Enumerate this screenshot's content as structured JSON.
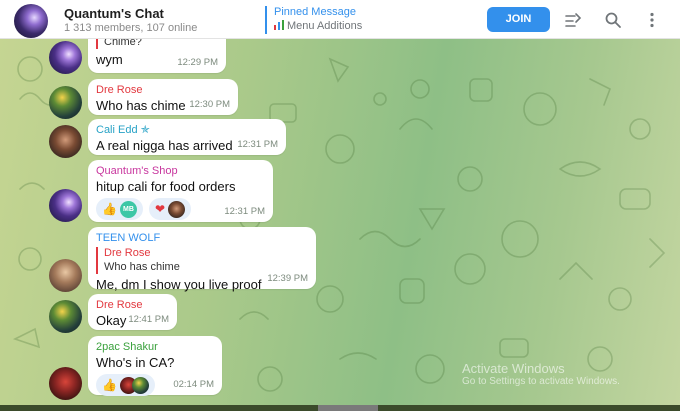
{
  "header": {
    "title": "Quantum's Chat",
    "subtitle": "1 313 members, 107 online",
    "pinned_label": "Pinned Message",
    "pinned_text": "Menu Additions",
    "join_label": "JOIN",
    "icons": [
      "chat-avatar",
      "topics-icon",
      "search-icon",
      "more-vertical-icon"
    ]
  },
  "colors": {
    "accent": "#3390ec",
    "bubble": "#ffffff",
    "dre_rose": "#e2383f",
    "cali_edd": "#27a2c6",
    "quantum_shop": "#c8369e",
    "teen_wolf": "#3390ec",
    "tupac": "#3aa13d"
  },
  "messages": [
    {
      "reply_name": "",
      "reply_text": "Chime?",
      "text": "wym",
      "time": "12:29 PM"
    },
    {
      "sender": "Dre Rose",
      "text": "Who has chime",
      "time": "12:30 PM"
    },
    {
      "sender": "Cali Edd",
      "text": "A real nigga has arrived",
      "time": "12:31 PM"
    },
    {
      "sender": "Quantum's Shop",
      "text": "hitup cali for food orders",
      "time": "12:31 PM",
      "reactions": [
        {
          "emoji": "👍",
          "badge": "MB"
        },
        {
          "emoji": "❤"
        }
      ]
    },
    {
      "sender": "TEEN WOLF",
      "reply_name": "Dre Rose",
      "reply_text": "Who has chime",
      "text": "Me, dm I show you live proof",
      "time": "12:39 PM"
    },
    {
      "sender": "Dre Rose",
      "text": "Okay",
      "time": "12:41 PM"
    },
    {
      "sender": "2pac Shakur",
      "text": "Who's in CA?",
      "time": "02:14 PM",
      "reactions": [
        {
          "emoji": "👍"
        }
      ]
    }
  ],
  "watermark": {
    "title": "Activate Windows",
    "text": "Go to Settings to activate Windows."
  }
}
